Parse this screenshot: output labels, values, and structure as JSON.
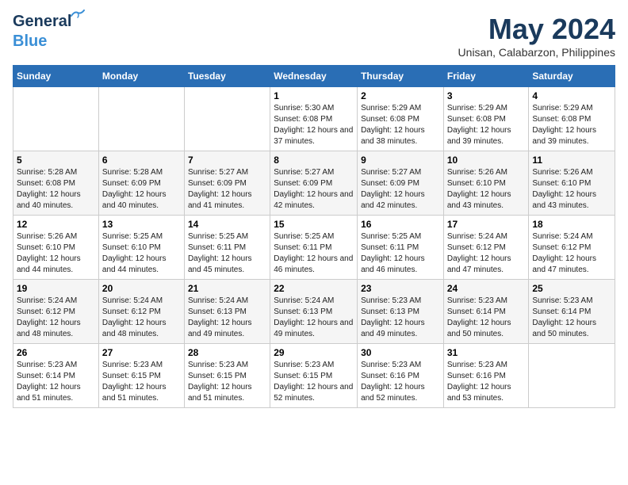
{
  "logo": {
    "general": "General",
    "blue": "Blue"
  },
  "header": {
    "month": "May 2024",
    "location": "Unisan, Calabarzon, Philippines"
  },
  "weekdays": [
    "Sunday",
    "Monday",
    "Tuesday",
    "Wednesday",
    "Thursday",
    "Friday",
    "Saturday"
  ],
  "weeks": [
    [
      {
        "day": "",
        "info": ""
      },
      {
        "day": "",
        "info": ""
      },
      {
        "day": "",
        "info": ""
      },
      {
        "day": "1",
        "info": "Sunrise: 5:30 AM\nSunset: 6:08 PM\nDaylight: 12 hours and 37 minutes."
      },
      {
        "day": "2",
        "info": "Sunrise: 5:29 AM\nSunset: 6:08 PM\nDaylight: 12 hours and 38 minutes."
      },
      {
        "day": "3",
        "info": "Sunrise: 5:29 AM\nSunset: 6:08 PM\nDaylight: 12 hours and 39 minutes."
      },
      {
        "day": "4",
        "info": "Sunrise: 5:29 AM\nSunset: 6:08 PM\nDaylight: 12 hours and 39 minutes."
      }
    ],
    [
      {
        "day": "5",
        "info": "Sunrise: 5:28 AM\nSunset: 6:08 PM\nDaylight: 12 hours and 40 minutes."
      },
      {
        "day": "6",
        "info": "Sunrise: 5:28 AM\nSunset: 6:09 PM\nDaylight: 12 hours and 40 minutes."
      },
      {
        "day": "7",
        "info": "Sunrise: 5:27 AM\nSunset: 6:09 PM\nDaylight: 12 hours and 41 minutes."
      },
      {
        "day": "8",
        "info": "Sunrise: 5:27 AM\nSunset: 6:09 PM\nDaylight: 12 hours and 42 minutes."
      },
      {
        "day": "9",
        "info": "Sunrise: 5:27 AM\nSunset: 6:09 PM\nDaylight: 12 hours and 42 minutes."
      },
      {
        "day": "10",
        "info": "Sunrise: 5:26 AM\nSunset: 6:10 PM\nDaylight: 12 hours and 43 minutes."
      },
      {
        "day": "11",
        "info": "Sunrise: 5:26 AM\nSunset: 6:10 PM\nDaylight: 12 hours and 43 minutes."
      }
    ],
    [
      {
        "day": "12",
        "info": "Sunrise: 5:26 AM\nSunset: 6:10 PM\nDaylight: 12 hours and 44 minutes."
      },
      {
        "day": "13",
        "info": "Sunrise: 5:25 AM\nSunset: 6:10 PM\nDaylight: 12 hours and 44 minutes."
      },
      {
        "day": "14",
        "info": "Sunrise: 5:25 AM\nSunset: 6:11 PM\nDaylight: 12 hours and 45 minutes."
      },
      {
        "day": "15",
        "info": "Sunrise: 5:25 AM\nSunset: 6:11 PM\nDaylight: 12 hours and 46 minutes."
      },
      {
        "day": "16",
        "info": "Sunrise: 5:25 AM\nSunset: 6:11 PM\nDaylight: 12 hours and 46 minutes."
      },
      {
        "day": "17",
        "info": "Sunrise: 5:24 AM\nSunset: 6:12 PM\nDaylight: 12 hours and 47 minutes."
      },
      {
        "day": "18",
        "info": "Sunrise: 5:24 AM\nSunset: 6:12 PM\nDaylight: 12 hours and 47 minutes."
      }
    ],
    [
      {
        "day": "19",
        "info": "Sunrise: 5:24 AM\nSunset: 6:12 PM\nDaylight: 12 hours and 48 minutes."
      },
      {
        "day": "20",
        "info": "Sunrise: 5:24 AM\nSunset: 6:12 PM\nDaylight: 12 hours and 48 minutes."
      },
      {
        "day": "21",
        "info": "Sunrise: 5:24 AM\nSunset: 6:13 PM\nDaylight: 12 hours and 49 minutes."
      },
      {
        "day": "22",
        "info": "Sunrise: 5:24 AM\nSunset: 6:13 PM\nDaylight: 12 hours and 49 minutes."
      },
      {
        "day": "23",
        "info": "Sunrise: 5:23 AM\nSunset: 6:13 PM\nDaylight: 12 hours and 49 minutes."
      },
      {
        "day": "24",
        "info": "Sunrise: 5:23 AM\nSunset: 6:14 PM\nDaylight: 12 hours and 50 minutes."
      },
      {
        "day": "25",
        "info": "Sunrise: 5:23 AM\nSunset: 6:14 PM\nDaylight: 12 hours and 50 minutes."
      }
    ],
    [
      {
        "day": "26",
        "info": "Sunrise: 5:23 AM\nSunset: 6:14 PM\nDaylight: 12 hours and 51 minutes."
      },
      {
        "day": "27",
        "info": "Sunrise: 5:23 AM\nSunset: 6:15 PM\nDaylight: 12 hours and 51 minutes."
      },
      {
        "day": "28",
        "info": "Sunrise: 5:23 AM\nSunset: 6:15 PM\nDaylight: 12 hours and 51 minutes."
      },
      {
        "day": "29",
        "info": "Sunrise: 5:23 AM\nSunset: 6:15 PM\nDaylight: 12 hours and 52 minutes."
      },
      {
        "day": "30",
        "info": "Sunrise: 5:23 AM\nSunset: 6:16 PM\nDaylight: 12 hours and 52 minutes."
      },
      {
        "day": "31",
        "info": "Sunrise: 5:23 AM\nSunset: 6:16 PM\nDaylight: 12 hours and 53 minutes."
      },
      {
        "day": "",
        "info": ""
      }
    ]
  ]
}
